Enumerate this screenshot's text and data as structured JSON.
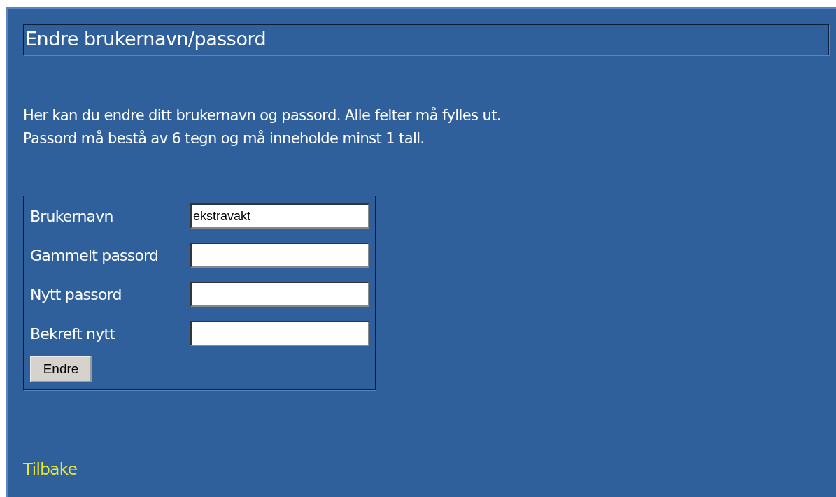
{
  "title": "Endre brukernavn/passord",
  "intro": [
    "Her kan du endre ditt brukernavn og passord. Alle felter må fylles ut.",
    "Passord må bestå av 6 tegn og må inneholde minst 1 tall."
  ],
  "form": {
    "fields": [
      {
        "label": "Brukernavn",
        "value": "ekstravakt"
      },
      {
        "label": "Gammelt passord"
      },
      {
        "label": "Nytt passord"
      },
      {
        "label": "Bekreft nytt"
      }
    ],
    "submit": "Endre"
  },
  "back_link": "Tilbake"
}
